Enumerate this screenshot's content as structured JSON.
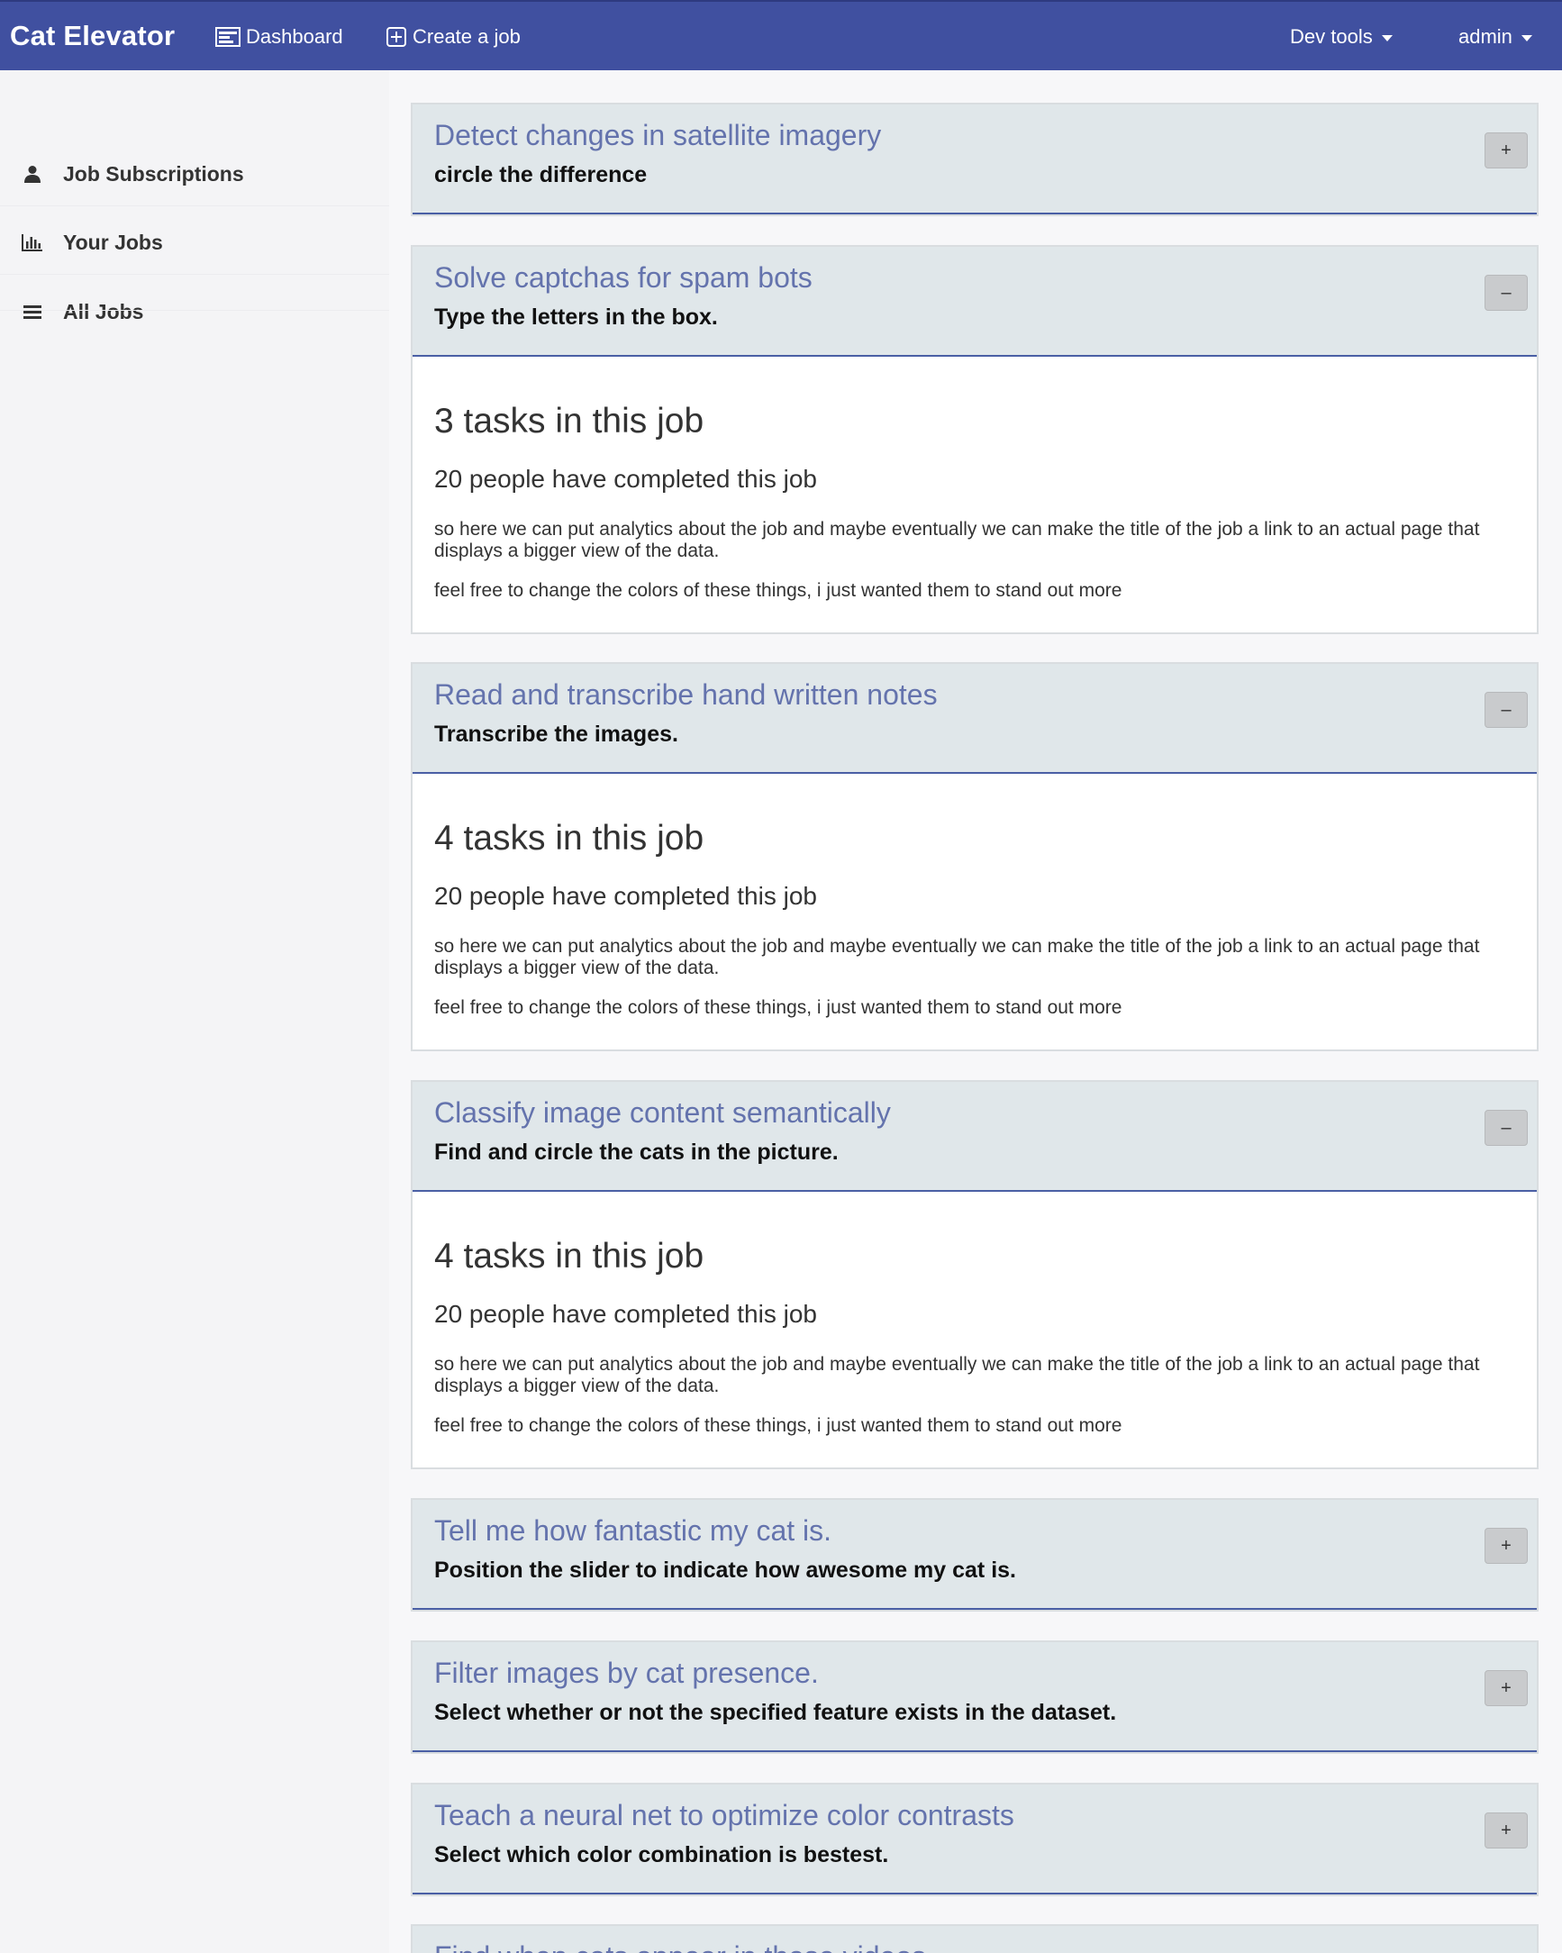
{
  "navbar": {
    "brand": "Cat Elevator",
    "links": [
      {
        "label": "Dashboard",
        "icon": "dashboard-icon"
      },
      {
        "label": "Create a job",
        "icon": "plus-square-icon"
      }
    ],
    "dev_tools": "Dev tools",
    "user": "admin"
  },
  "sidebar": {
    "items": [
      {
        "label": "Job Subscriptions",
        "icon": "user-icon"
      },
      {
        "label": "Your Jobs",
        "icon": "bar-chart-icon"
      },
      {
        "label": "All Jobs",
        "icon": "list-icon"
      }
    ]
  },
  "colors": {
    "navbar": "#4050a0",
    "job_title": "#6473ad",
    "job_header_bg": "#e0e7ea"
  },
  "jobs": [
    {
      "title": "Detect changes in satellite imagery",
      "subtitle": "circle the difference",
      "expanded": false,
      "toggle": "+"
    },
    {
      "title": "Solve captchas for spam bots",
      "subtitle": "Type the letters in the box.",
      "expanded": true,
      "toggle": "–",
      "tasks": "3 tasks in this job",
      "people": "20 people have completed this job",
      "note1": "so here we can put analytics about the job and maybe eventually we can make the title of the job a link to an actual page that displays a bigger view of the data.",
      "note2": "feel free to change the colors of these things, i just wanted them to stand out more"
    },
    {
      "title": "Read and transcribe hand written notes",
      "subtitle": "Transcribe the images.",
      "expanded": true,
      "toggle": "–",
      "tasks": "4 tasks in this job",
      "people": "20 people have completed this job",
      "note1": "so here we can put analytics about the job and maybe eventually we can make the title of the job a link to an actual page that displays a bigger view of the data.",
      "note2": "feel free to change the colors of these things, i just wanted them to stand out more"
    },
    {
      "title": "Classify image content semantically",
      "subtitle": "Find and circle the cats in the picture.",
      "expanded": true,
      "toggle": "–",
      "tasks": "4 tasks in this job",
      "people": "20 people have completed this job",
      "note1": "so here we can put analytics about the job and maybe eventually we can make the title of the job a link to an actual page that displays a bigger view of the data.",
      "note2": "feel free to change the colors of these things, i just wanted them to stand out more"
    },
    {
      "title": "Tell me how fantastic my cat is.",
      "subtitle": "Position the slider to indicate how awesome my cat is.",
      "expanded": false,
      "toggle": "+"
    },
    {
      "title": "Filter images by cat presence.",
      "subtitle": "Select whether or not the specified feature exists in the dataset.",
      "expanded": false,
      "toggle": "+"
    },
    {
      "title": "Teach a neural net to optimize color contrasts",
      "subtitle": "Select which color combination is bestest.",
      "expanded": false,
      "toggle": "+"
    },
    {
      "title": "Find when cats appear in these videos",
      "subtitle": "",
      "expanded": false,
      "toggle": "+"
    }
  ]
}
